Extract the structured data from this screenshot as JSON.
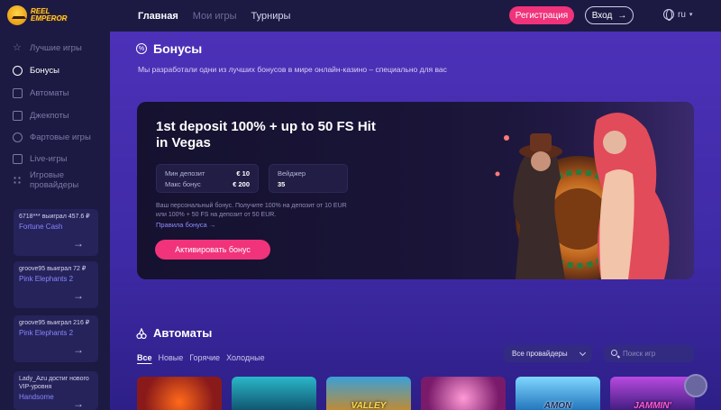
{
  "header": {
    "logo_text_1": "REEL",
    "logo_text_2": "EMPEROR",
    "nav": [
      {
        "label": "Главная",
        "active": true
      },
      {
        "label": "Мои игры",
        "active": false
      },
      {
        "label": "Турниры",
        "active": false
      }
    ],
    "register_label": "Регистрация",
    "login_label": "Вход",
    "lang": "ru"
  },
  "sidebar": {
    "items": [
      {
        "label": "Лучшие игры",
        "icon": "star-icon"
      },
      {
        "label": "Бонусы",
        "icon": "percent-icon",
        "active": true
      },
      {
        "label": "Автоматы",
        "icon": "slot-icon"
      },
      {
        "label": "Джекпоты",
        "icon": "trophy-icon"
      },
      {
        "label": "Фартовые игры",
        "icon": "flame-icon"
      },
      {
        "label": "Live-игры",
        "icon": "live-icon"
      },
      {
        "label": "Игровые провайдеры",
        "icon": "providers-icon"
      }
    ],
    "wins": [
      {
        "text": "6718*** выиграл 457.6 ₽",
        "game": "Fortune Cash"
      },
      {
        "text": "groove95 выиграл 72 ₽",
        "game": "Pink Elephants 2"
      },
      {
        "text": "groove95 выиграл 216 ₽",
        "game": "Pink Elephants 2"
      },
      {
        "text": "Lady_Azu достиг нового VIP-уровня",
        "game": "Handsome"
      }
    ]
  },
  "bonuses": {
    "title": "Бонусы",
    "subtitle": "Мы разработали одни из лучших бонусов в мире онлайн-казино – специально для вас",
    "promo": {
      "title": "1st deposit 100% + up to 50 FS Hit in Vegas",
      "min_deposit_label": "Мин депозит",
      "min_deposit_value": "€ 10",
      "max_bonus_label": "Макс бонус",
      "max_bonus_value": "€ 200",
      "wager_label": "Вейджер",
      "wager_value": "35",
      "description": "Ваш персональный бонус. Получите 100% на депозит от 10 EUR или 100% + 50 FS на депозит от 50 EUR.",
      "rules_link": "Правила бонуса →",
      "activate_label": "Активировать бонус"
    }
  },
  "slots": {
    "title": "Автоматы",
    "tabs": [
      {
        "label": "Все",
        "active": true
      },
      {
        "label": "Новые",
        "active": false
      },
      {
        "label": "Горячие",
        "active": false
      },
      {
        "label": "Холодные",
        "active": false
      }
    ],
    "provider_select": "Все провайдеры",
    "search_placeholder": "Поиск игр",
    "tiles": [
      {
        "label": "",
        "color": "#8a1a1a"
      },
      {
        "label": "",
        "color": "#1f7f8a"
      },
      {
        "label": "VALLEY",
        "color": "#c98a2a"
      },
      {
        "label": "",
        "color": "#d14a9e"
      },
      {
        "label": "AMON",
        "color": "#3a9fe0"
      },
      {
        "label": "JAMMIN'",
        "color": "#6a2ab8"
      }
    ]
  },
  "colors": {
    "accent": "#f0337a",
    "link": "#8a86ff",
    "main_bg": "#4c31b8",
    "sidebar_bg": "#1c1a42"
  }
}
